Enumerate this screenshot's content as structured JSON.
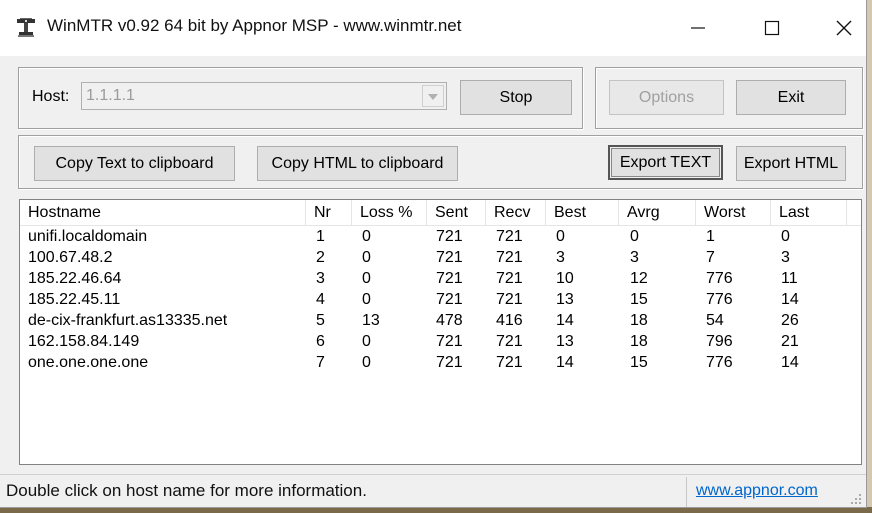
{
  "window": {
    "title": "WinMTR v0.92 64 bit by Appnor MSP - www.winmtr.net"
  },
  "controls": {
    "host_label": "Host:",
    "host_value": "1.1.1.1",
    "stop_label": "Stop",
    "options_label": "Options",
    "exit_label": "Exit",
    "copy_text_label": "Copy Text to clipboard",
    "copy_html_label": "Copy HTML to clipboard",
    "export_text_label": "Export TEXT",
    "export_html_label": "Export HTML"
  },
  "table": {
    "columns": [
      "Hostname",
      "Nr",
      "Loss %",
      "Sent",
      "Recv",
      "Best",
      "Avrg",
      "Worst",
      "Last"
    ],
    "rows": [
      [
        "unifi.localdomain",
        "1",
        "0",
        "721",
        "721",
        "0",
        "0",
        "1",
        "0"
      ],
      [
        "100.67.48.2",
        "2",
        "0",
        "721",
        "721",
        "3",
        "3",
        "7",
        "3"
      ],
      [
        "185.22.46.64",
        "3",
        "0",
        "721",
        "721",
        "10",
        "12",
        "776",
        "11"
      ],
      [
        "185.22.45.11",
        "4",
        "0",
        "721",
        "721",
        "13",
        "15",
        "776",
        "14"
      ],
      [
        "de-cix-frankfurt.as13335.net",
        "5",
        "13",
        "478",
        "416",
        "14",
        "18",
        "54",
        "26"
      ],
      [
        "162.158.84.149",
        "6",
        "0",
        "721",
        "721",
        "13",
        "18",
        "796",
        "21"
      ],
      [
        "one.one.one.one",
        "7",
        "0",
        "721",
        "721",
        "14",
        "15",
        "776",
        "14"
      ]
    ]
  },
  "status": {
    "hint": "Double click on host name for more information.",
    "link": "www.appnor.com"
  },
  "icons": {
    "app": "network-tower-icon",
    "minimize": "minimize-icon",
    "maximize": "maximize-icon",
    "close": "close-icon",
    "dropdown": "chevron-down-icon",
    "grip": "resize-grip-icon"
  }
}
